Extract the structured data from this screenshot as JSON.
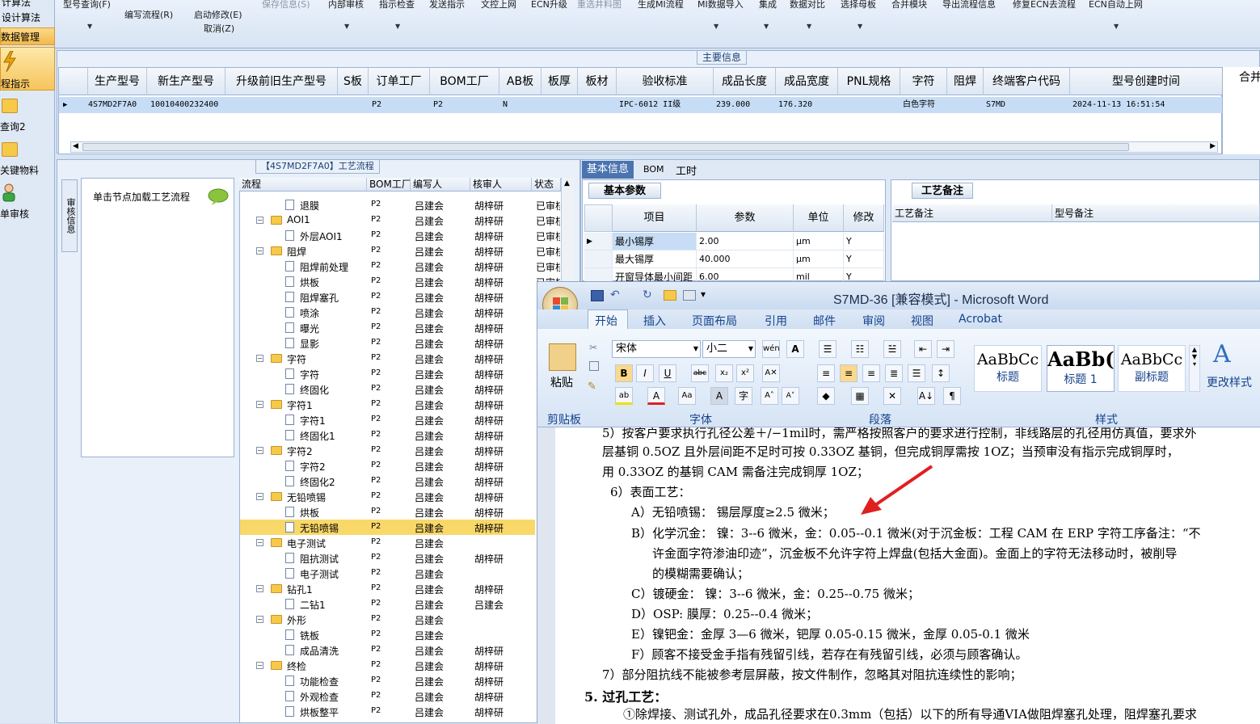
{
  "toolbar": {
    "items": [
      "型号查询(F)",
      "编写流程(R)",
      "启动修改(E)",
      "取消(Z)",
      "保存信息(S)",
      "内部审核",
      "指示检查",
      "发送指示",
      "文控上网",
      "ECN升级",
      "重选井料图",
      "生成MI流程",
      "MI数据导入",
      "集成",
      "数据对比",
      "选择母板",
      "合并模块",
      "导出流程信息",
      "修复ECN去流程",
      "ECN自动上网"
    ]
  },
  "left_nav": {
    "items": [
      "计算法",
      "设计算法",
      "数据管理",
      "程指示",
      "查询2",
      "关键物料",
      "单审核"
    ]
  },
  "main_info": {
    "title": "主要信息",
    "right_header": "合并",
    "columns": [
      "生产型号",
      "新生产型号",
      "升级前旧生产型号",
      "S板",
      "订单工厂",
      "BOM工厂",
      "AB板",
      "板厚",
      "板材",
      "验收标准",
      "成品长度",
      "成品宽度",
      "PNL规格",
      "字符",
      "阻焊",
      "终端客户代码",
      "型号创建时间"
    ],
    "row": {
      "prod_no": "4S7MD2F7A0",
      "new_no": "10010400232400",
      "order_factory": "P2",
      "bom_factory": "P2",
      "ab": "N",
      "standard": "IPC-6012 II级",
      "length": "239.000",
      "width": "176.320",
      "char": "白色字符",
      "end_customer": "S7MD",
      "created": "2024-11-13 16:51:54"
    }
  },
  "process": {
    "title": "【4S7MD2F7A0】工艺流程",
    "side_tab": "审核信息",
    "hint": "单击节点加载工艺流程",
    "columns": [
      "流程",
      "BOM工厂",
      "编写人",
      "核审人",
      "状态"
    ],
    "rows": [
      {
        "name": "退膜",
        "level": 2,
        "bom": "P2",
        "writer": "吕建会",
        "reviewer": "胡梓研",
        "status": "已审核"
      },
      {
        "name": "AOI1",
        "level": 1,
        "bom": "P2",
        "writer": "吕建会",
        "reviewer": "胡梓研",
        "status": "已审核"
      },
      {
        "name": "外层AOI1",
        "level": 2,
        "bom": "P2",
        "writer": "吕建会",
        "reviewer": "胡梓研",
        "status": "已审核"
      },
      {
        "name": "阻焊",
        "level": 1,
        "bom": "P2",
        "writer": "吕建会",
        "reviewer": "胡梓研",
        "status": "已审核"
      },
      {
        "name": "阻焊前处理",
        "level": 2,
        "bom": "P2",
        "writer": "吕建会",
        "reviewer": "胡梓研",
        "status": "已审核"
      },
      {
        "name": "烘板",
        "level": 2,
        "bom": "P2",
        "writer": "吕建会",
        "reviewer": "胡梓研",
        "status": "已审核"
      },
      {
        "name": "阻焊塞孔",
        "level": 2,
        "bom": "P2",
        "writer": "吕建会",
        "reviewer": "胡梓研",
        "status": "已审核"
      },
      {
        "name": "喷涂",
        "level": 2,
        "bom": "P2",
        "writer": "吕建会",
        "reviewer": "胡梓研",
        "status": "已审核"
      },
      {
        "name": "曝光",
        "level": 2,
        "bom": "P2",
        "writer": "吕建会",
        "reviewer": "胡梓研",
        "status": "已审核"
      },
      {
        "name": "显影",
        "level": 2,
        "bom": "P2",
        "writer": "吕建会",
        "reviewer": "胡梓研",
        "status": "已审核"
      },
      {
        "name": "字符",
        "level": 1,
        "bom": "P2",
        "writer": "吕建会",
        "reviewer": "胡梓研",
        "status": "已审核"
      },
      {
        "name": "字符",
        "level": 2,
        "bom": "P2",
        "writer": "吕建会",
        "reviewer": "胡梓研",
        "status": "已审核"
      },
      {
        "name": "终固化",
        "level": 2,
        "bom": "P2",
        "writer": "吕建会",
        "reviewer": "胡梓研",
        "status": "已审核"
      },
      {
        "name": "字符1",
        "level": 1,
        "bom": "P2",
        "writer": "吕建会",
        "reviewer": "胡梓研",
        "status": "已审核"
      },
      {
        "name": "字符1",
        "level": 2,
        "bom": "P2",
        "writer": "吕建会",
        "reviewer": "胡梓研",
        "status": "已审核"
      },
      {
        "name": "终固化1",
        "level": 2,
        "bom": "P2",
        "writer": "吕建会",
        "reviewer": "胡梓研",
        "status": "已审核"
      },
      {
        "name": "字符2",
        "level": 1,
        "bom": "P2",
        "writer": "吕建会",
        "reviewer": "胡梓研",
        "status": "已审核"
      },
      {
        "name": "字符2",
        "level": 2,
        "bom": "P2",
        "writer": "吕建会",
        "reviewer": "胡梓研",
        "status": "已审核"
      },
      {
        "name": "终固化2",
        "level": 2,
        "bom": "P2",
        "writer": "吕建会",
        "reviewer": "胡梓研",
        "status": "已审核"
      },
      {
        "name": "无铅喷锡",
        "level": 1,
        "bom": "P2",
        "writer": "吕建会",
        "reviewer": "胡梓研",
        "status": "已审核"
      },
      {
        "name": "烘板",
        "level": 2,
        "bom": "P2",
        "writer": "吕建会",
        "reviewer": "胡梓研",
        "status": "已审核"
      },
      {
        "name": "无铅喷锡",
        "level": 2,
        "bom": "P2",
        "writer": "吕建会",
        "reviewer": "胡梓研",
        "status": "已审核",
        "selected": true
      },
      {
        "name": "电子测试",
        "level": 1,
        "bom": "P2",
        "writer": "吕建会",
        "reviewer": "",
        "status": ""
      },
      {
        "name": "阻抗测试",
        "level": 2,
        "bom": "P2",
        "writer": "吕建会",
        "reviewer": "胡梓研",
        "status": ""
      },
      {
        "name": "电子测试",
        "level": 2,
        "bom": "P2",
        "writer": "吕建会",
        "reviewer": "",
        "status": ""
      },
      {
        "name": "钻孔1",
        "level": 1,
        "bom": "P2",
        "writer": "吕建会",
        "reviewer": "胡梓研",
        "status": ""
      },
      {
        "name": "二钻1",
        "level": 2,
        "bom": "P2",
        "writer": "吕建会",
        "reviewer": "吕建会",
        "status": ""
      },
      {
        "name": "外形",
        "level": 1,
        "bom": "P2",
        "writer": "吕建会",
        "reviewer": "",
        "status": ""
      },
      {
        "name": "铣板",
        "level": 2,
        "bom": "P2",
        "writer": "吕建会",
        "reviewer": "",
        "status": ""
      },
      {
        "name": "成品清洗",
        "level": 2,
        "bom": "P2",
        "writer": "吕建会",
        "reviewer": "胡梓研",
        "status": ""
      },
      {
        "name": "终检",
        "level": 1,
        "bom": "P2",
        "writer": "吕建会",
        "reviewer": "胡梓研",
        "status": ""
      },
      {
        "name": "功能检查",
        "level": 2,
        "bom": "P2",
        "writer": "吕建会",
        "reviewer": "胡梓研",
        "status": ""
      },
      {
        "name": "外观检查",
        "level": 2,
        "bom": "P2",
        "writer": "吕建会",
        "reviewer": "胡梓研",
        "status": ""
      },
      {
        "name": "烘板整平",
        "level": 2,
        "bom": "P2",
        "writer": "吕建会",
        "reviewer": "胡梓研",
        "status": ""
      }
    ]
  },
  "details": {
    "tabs": [
      "基本信息",
      "BOM",
      "工时"
    ],
    "params_tab": "基本参数",
    "notes_tab": "工艺备注",
    "param_columns": [
      "项目",
      "参数",
      "单位",
      "修改"
    ],
    "params": [
      {
        "item": "最小锡厚",
        "value": "2.00",
        "unit": "μm",
        "mod": "Y"
      },
      {
        "item": "最大锡厚",
        "value": "40.000",
        "unit": "μm",
        "mod": "Y"
      },
      {
        "item": "开窗导体最小间距",
        "value": "6.00",
        "unit": "mil",
        "mod": "Y"
      }
    ],
    "note_columns": [
      "工艺备注",
      "型号备注"
    ]
  },
  "word": {
    "title": "S7MD-36 [兼容模式] - Microsoft Word",
    "tabs": [
      "开始",
      "插入",
      "页面布局",
      "引用",
      "邮件",
      "审阅",
      "视图",
      "Acrobat"
    ],
    "font_name": "宋体",
    "font_size": "小二",
    "paste_label": "粘贴",
    "groups": [
      "剪贴板",
      "字体",
      "段落",
      "样式"
    ],
    "styles": [
      {
        "preview": "AaBbCc",
        "label": "标题"
      },
      {
        "preview": "AaBb(",
        "label": "标题 1"
      },
      {
        "preview": "AaBbCc",
        "label": "副标题"
      }
    ],
    "change_styles": "更改样式",
    "lines": [
      "5）按客户要求执行孔径公差＋/−1mil时，需严格按照客户的要求进行控制，非线路层的孔径用仿真值，要求外",
      "层基铜 0.5OZ 且外层间距不足时可按 0.33OZ 基铜，但完成铜厚需按 1OZ；当预审没有指示完成铜厚时，",
      "用 0.33OZ 的基铜 CAM 需备注完成铜厚 1OZ；",
      "6）表面工艺：",
      "A）无铅喷锡：  锡层厚度≥2.5 微米；",
      "B）化学沉金：  镍：3--6 微米，金：0.05--0.1 微米(对于沉金板：工程 CAM 在 ERP 字符工序备注：“不",
      "许金面字符渗油印迹”，沉金板不允许字符上焊盘(包括大金面)。金面上的字符无法移动时，被削导",
      "的模糊需要确认；",
      "C）镀硬金：    镍：3--6 微米，金：0.25--0.75 微米；",
      "D）OSP:        膜厚：0.25--0.4 微米；",
      "E）镍钯金：金厚 3—6 微米，钯厚 0.05-0.15 微米，金厚 0.05-0.1 微米",
      "F）顾客不接受金手指有残留引线，若存在有残留引线，必须与顾客确认。",
      "7）部分阻抗线不能被参考层屏蔽，按文件制作，忽略其对阻抗连续性的影响；",
      "5.  过孔工艺：",
      "①除焊接、测试孔外，成品孔径要求在0.3mm（包括）以下的所有导通VIA做阻焊塞孔处理，阻焊塞孔要求"
    ]
  },
  "colors": {
    "selected_row": "#c7ddf6",
    "tree_selected": "#f9d86a",
    "accent": "#15428b",
    "arrow": "#e02020"
  }
}
